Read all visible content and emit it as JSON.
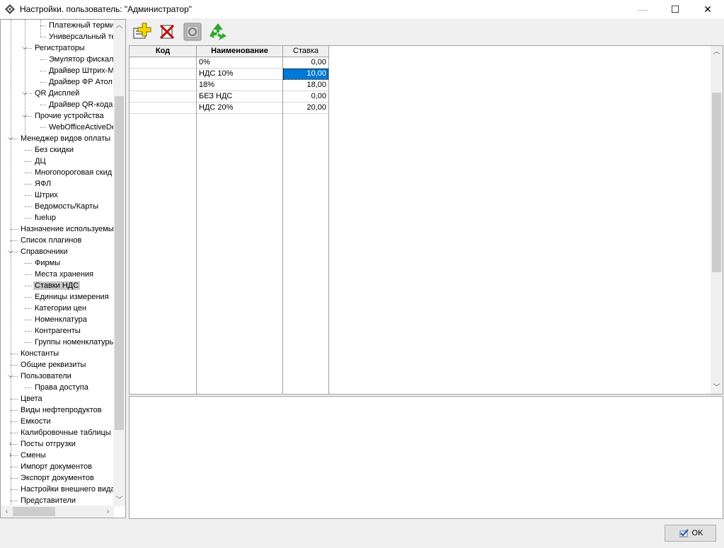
{
  "window": {
    "title": "Настройки. пользователь: \"Администратор\"",
    "minimize": "—",
    "maximize": "☐",
    "close": "✕"
  },
  "tree": {
    "items": [
      {
        "label": "Платежный терми",
        "level": 3,
        "expander": ""
      },
      {
        "label": "Универсальный те",
        "level": 3,
        "expander": ""
      },
      {
        "label": "Регистраторы",
        "level": 2,
        "expander": "open"
      },
      {
        "label": "Эмулятор фискаль",
        "level": 3,
        "expander": ""
      },
      {
        "label": "Драйвер Штрих-М",
        "level": 3,
        "expander": ""
      },
      {
        "label": "Драйвер ФР Атол",
        "level": 3,
        "expander": ""
      },
      {
        "label": "QR Дисплей",
        "level": 2,
        "expander": "open"
      },
      {
        "label": "Драйвер QR-кода",
        "level": 3,
        "expander": ""
      },
      {
        "label": "Прочие устройства",
        "level": 2,
        "expander": "open"
      },
      {
        "label": "WebOfficeActiveDe",
        "level": 3,
        "expander": ""
      },
      {
        "label": "Менеджер видов оплаты",
        "level": 1,
        "expander": "open"
      },
      {
        "label": "Без скидки",
        "level": 2,
        "expander": ""
      },
      {
        "label": "ДЦ",
        "level": 2,
        "expander": ""
      },
      {
        "label": "Многопороговая скид",
        "level": 2,
        "expander": ""
      },
      {
        "label": "ЯФЛ",
        "level": 2,
        "expander": ""
      },
      {
        "label": "Штрих",
        "level": 2,
        "expander": ""
      },
      {
        "label": "Ведомость/Карты",
        "level": 2,
        "expander": ""
      },
      {
        "label": "fuelup",
        "level": 2,
        "expander": ""
      },
      {
        "label": "Назначение используемых",
        "level": 1,
        "expander": ""
      },
      {
        "label": "Список плагинов",
        "level": 1,
        "expander": ""
      },
      {
        "label": "Справочники",
        "level": 1,
        "expander": "open"
      },
      {
        "label": "Фирмы",
        "level": 2,
        "expander": ""
      },
      {
        "label": "Места хранения",
        "level": 2,
        "expander": ""
      },
      {
        "label": "Ставки НДС",
        "level": 2,
        "expander": "",
        "selected": true
      },
      {
        "label": "Единицы измерения",
        "level": 2,
        "expander": ""
      },
      {
        "label": "Категории цен",
        "level": 2,
        "expander": ""
      },
      {
        "label": "Номенклатура",
        "level": 2,
        "expander": ""
      },
      {
        "label": "Контрагенты",
        "level": 2,
        "expander": ""
      },
      {
        "label": "Группы номенклатуры",
        "level": 2,
        "expander": ""
      },
      {
        "label": "Константы",
        "level": 1,
        "expander": ""
      },
      {
        "label": "Общие реквизиты",
        "level": 1,
        "expander": ""
      },
      {
        "label": "Пользователи",
        "level": 1,
        "expander": "open"
      },
      {
        "label": "Права доступа",
        "level": 2,
        "expander": ""
      },
      {
        "label": "Цвета",
        "level": 1,
        "expander": ""
      },
      {
        "label": "Виды нефтепродуктов",
        "level": 1,
        "expander": ""
      },
      {
        "label": "Емкости",
        "level": 1,
        "expander": ""
      },
      {
        "label": "Калибровочные таблицы",
        "level": 1,
        "expander": ""
      },
      {
        "label": "Посты отгрузки",
        "level": 1,
        "expander": "closed"
      },
      {
        "label": "Смены",
        "level": 1,
        "expander": "closed"
      },
      {
        "label": "Импорт документов",
        "level": 1,
        "expander": ""
      },
      {
        "label": "Экспорт документов",
        "level": 1,
        "expander": ""
      },
      {
        "label": "Настройки внешнего вида",
        "level": 1,
        "expander": ""
      },
      {
        "label": "Представители",
        "level": 1,
        "expander": ""
      }
    ]
  },
  "toolbar": {
    "buttons": [
      {
        "name": "add-record-button",
        "icon": "add-document-icon",
        "enabled": true
      },
      {
        "name": "delete-record-button",
        "icon": "delete-record-icon",
        "enabled": true
      },
      {
        "name": "edit-record-button",
        "icon": "edit-record-icon",
        "enabled": false
      },
      {
        "name": "refresh-button",
        "icon": "recycle-refresh-icon",
        "enabled": true
      }
    ]
  },
  "grid": {
    "columns": [
      "Код",
      "Наименование",
      "Ставка"
    ],
    "rows": [
      {
        "code": "",
        "name": "0%",
        "rate": "0,00"
      },
      {
        "code": "",
        "name": "НДС 10%",
        "rate": "10,00",
        "selected": true
      },
      {
        "code": "",
        "name": "18%",
        "rate": "18,00"
      },
      {
        "code": "",
        "name": "БЕЗ НДС",
        "rate": "0,00"
      },
      {
        "code": "",
        "name": "НДС 20%",
        "rate": "20,00"
      }
    ]
  },
  "footer": {
    "ok_label": "OK"
  },
  "colors": {
    "selection": "#0078d7",
    "tree_selection": "#c8c8c8"
  }
}
